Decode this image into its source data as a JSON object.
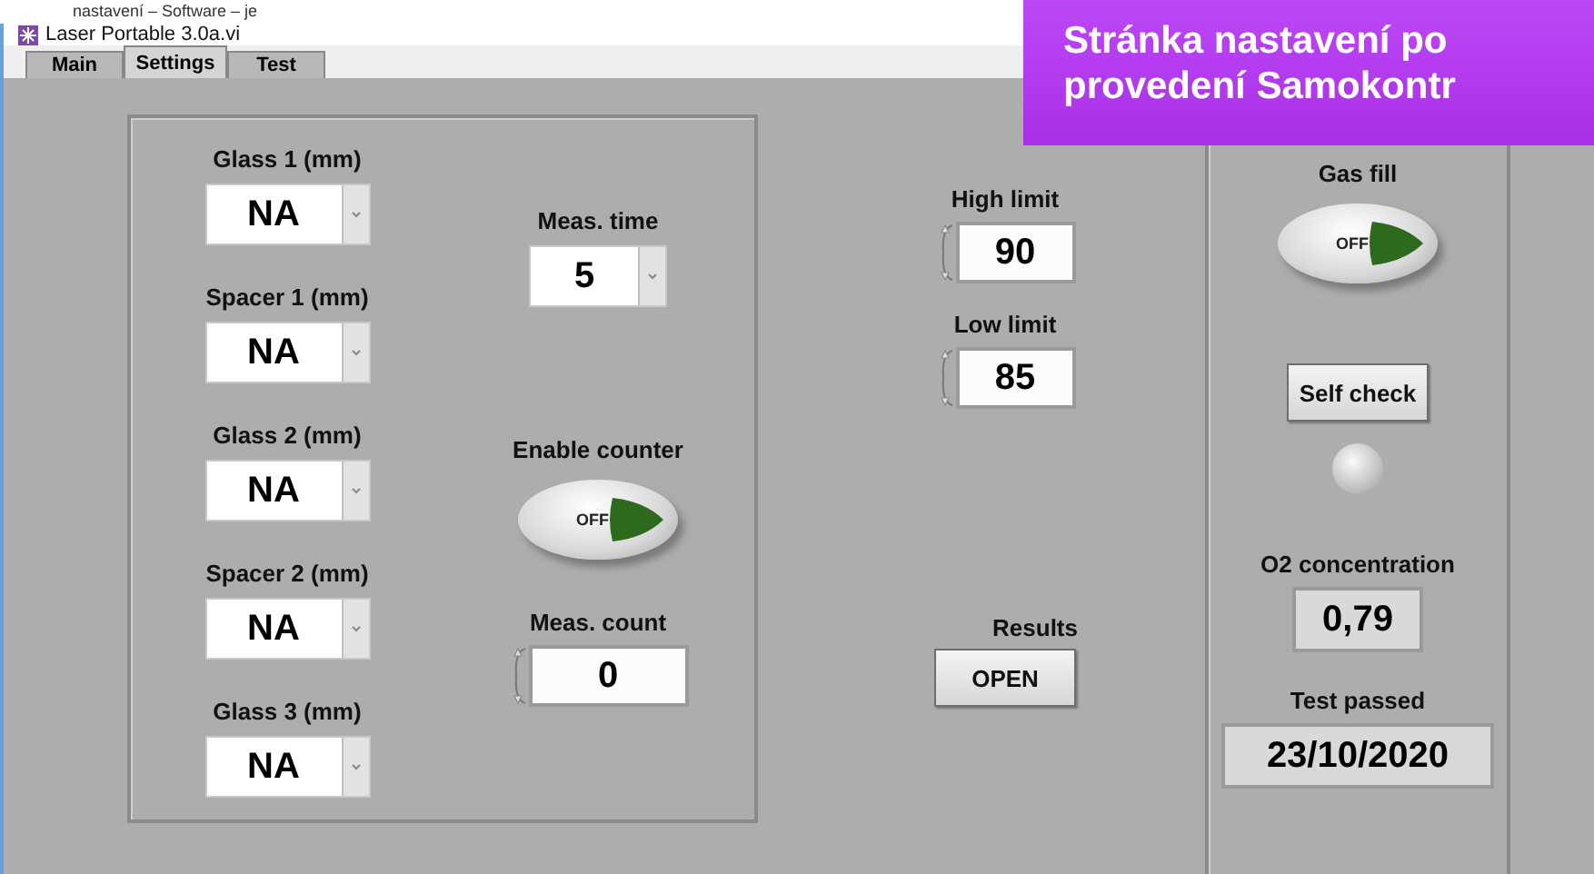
{
  "caption_strip": {
    "text": "nastavení – Software – je"
  },
  "overlay_banner": {
    "lines": [
      "Stránka nastavení po",
      "provedení Samokontr"
    ]
  },
  "window": {
    "title": "Laser Portable 3.0a.vi"
  },
  "tabs": [
    {
      "label": "Main",
      "selected": false
    },
    {
      "label": "Settings",
      "selected": true
    },
    {
      "label": "Test",
      "selected": false
    }
  ],
  "settings_panel": {
    "selectors": [
      {
        "label": "Glass 1 (mm)",
        "value": "NA"
      },
      {
        "label": "Spacer 1 (mm)",
        "value": "NA"
      },
      {
        "label": "Glass 2 (mm)",
        "value": "NA"
      },
      {
        "label": "Spacer 2 (mm)",
        "value": "NA"
      },
      {
        "label": "Glass 3 (mm)",
        "value": "NA"
      }
    ],
    "meas_time": {
      "label": "Meas. time",
      "value": "5"
    },
    "enable_counter": {
      "label": "Enable counter",
      "text": "OFF",
      "on": false
    },
    "meas_count": {
      "label": "Meas. count",
      "value": "0"
    }
  },
  "limits": [
    {
      "label": "High limit",
      "value": "90"
    },
    {
      "label": "Low limit",
      "value": "85"
    }
  ],
  "results": {
    "label": "Results",
    "button": "OPEN"
  },
  "check_panel": {
    "gas_fill": {
      "label": "Gas fill",
      "text": "OFF",
      "on": false
    },
    "self_check": {
      "button": "Self check",
      "lit": false
    },
    "o2": {
      "label": "O2 concentration",
      "value": "0,79"
    },
    "test_passed": {
      "label": "Test passed",
      "value": "23/10/2020"
    }
  }
}
